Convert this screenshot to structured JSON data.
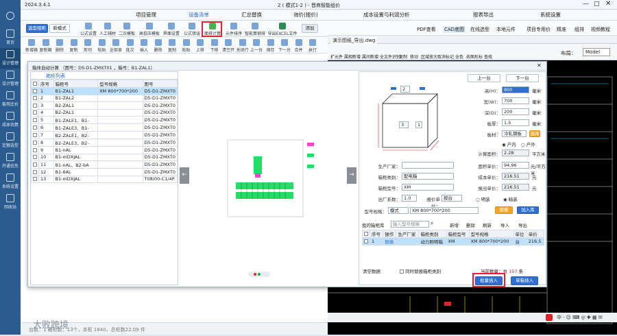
{
  "app": {
    "version": "2024.3.4.1",
    "window_title": "2 ( 模式1-2 ) - 晋商智能组价"
  },
  "sidebar": {
    "items": [
      {
        "label": "首页"
      },
      {
        "label": "设计管理"
      },
      {
        "label": "设计管理"
      },
      {
        "label": "套用比价"
      },
      {
        "label": "成本估算"
      },
      {
        "label": "定额选型"
      },
      {
        "label": "开通优先"
      },
      {
        "label": "系统设置"
      },
      {
        "label": "回收站"
      }
    ]
  },
  "menu": [
    "项目管理",
    "设备清单",
    "汇总替换",
    "询价(报价)",
    "成本设置与利润分析",
    "报表导出",
    "系统设置"
  ],
  "toolbar1": {
    "mode_btn": "选型组柜",
    "std_mode": "新模式",
    "items": [
      "公式设置",
      "人工辅材",
      "二次模板",
      "高低压模板",
      "界面设置",
      "公式错误",
      "面排计算",
      "元件排序",
      "智能算钢排",
      "导出EXCEL文件"
    ],
    "add": "添加",
    "right": [
      "PDF查看",
      "CAD底图",
      "在线选型",
      "本地元件",
      "项目专用价",
      "精准",
      "组排",
      "视频教程"
    ]
  },
  "toolbar2": [
    "新增箱号",
    "复制箱号",
    "删除",
    "复制",
    "剪切",
    "粘贴",
    "全部显示",
    "批次",
    "插入",
    "删除",
    "复制",
    "粘贴",
    "上移",
    "下移",
    "清空开票行",
    "关闭行",
    "上一台",
    "保存",
    "下一台",
    "合并",
    "执行"
  ],
  "cad": {
    "tab": "演示图纸_导出.dwg",
    "layout_label": "布局：",
    "layout_value": "Model",
    "tools": [
      "扩元件",
      "属相新增",
      "属间新增",
      "全文件识别",
      "复制",
      "移动",
      "区域放大",
      "取消标记",
      "全色",
      "去图形标",
      "查找"
    ]
  },
  "dialog": {
    "title": "箱体自动计算  （图号：D5-D1-ZMXT01 ，箱号：B1-ZAL1）",
    "tab": "箱柜列表",
    "columns": [
      "序号",
      "箱柜号",
      "型号规格",
      "图号"
    ],
    "rows": [
      [
        "1",
        "B1-ZAL1",
        "XM 800*700*200",
        "D5-D1-ZMXT0"
      ],
      [
        "2",
        "B1-ZAL2",
        "",
        "D5-D1-ZMXT0"
      ],
      [
        "3",
        "B2-ZAL1",
        "",
        "D5-D1-ZMXT0"
      ],
      [
        "4",
        "B2-ZAL1",
        "",
        "D5-D1-ZMXT0"
      ],
      [
        "5",
        "B1-ZALE1、B1-",
        "",
        "D5-D1-ZMXT0"
      ],
      [
        "6",
        "B1-ZALE3、B1-",
        "",
        "D5-D1-ZMXT0"
      ],
      [
        "7",
        "B2-ZALE1、B2-",
        "",
        "D5-D1-ZMXT0"
      ],
      [
        "8",
        "B2-ZALE3、B2-",
        "",
        "D5-D1-ZMXT0"
      ],
      [
        "9",
        "B1-nAL",
        "",
        "D5-D1-ZMXT0"
      ],
      [
        "10",
        "B1-mDXJAL",
        "",
        "D5-D1-ZMXT0"
      ],
      [
        "11",
        "B1-nAL、B2-bA",
        "",
        "D5-D1-ZMXT0"
      ],
      [
        "12",
        "B1-6AL",
        "",
        "D5-D1-ZMXT0"
      ],
      [
        "13",
        "B1-mDXJAL",
        "",
        "T08/00-C1/4P"
      ]
    ],
    "prev": "上一台",
    "next": "下一台",
    "dims": {
      "width_box": "2",
      "height_box": "3",
      "depth_box": "1"
    },
    "form": {
      "height_label": "高(H)：",
      "height": "800",
      "width_label": "宽(W)：",
      "width": "700",
      "depth_label": "深(D)：",
      "depth": "200",
      "thick_label": "板厚：",
      "thick": "1.5",
      "mat_label": "板材：",
      "mat": "冷轧钢板",
      "mat_btn": "选择",
      "radio1": "户内",
      "radio2": "户外",
      "area_label": "计算面积：",
      "area": "2.28",
      "area_unit": "平方米",
      "unit": "毫米",
      "mfr_label": "生产厂家：",
      "price_label": "面积单价：",
      "price": "94.96",
      "price_unit": "元/平方米",
      "cab_type_label": "箱柜类别：",
      "cab_type": "配电箱",
      "cost_label": "成本单价：",
      "cost": "216.51",
      "yuan": "元",
      "model_label": "箱柜型号：",
      "model": "XM",
      "quote_label": "报出单价：",
      "quote": "216.51",
      "factory_label": "出厂系数：",
      "factory": "1.0",
      "quote_unit_label": "报价单位：",
      "quote_unit": "按台",
      "r_open": "明装",
      "r_hide": "暗装",
      "spec_label": "型号规格：",
      "spec_mode": "模式",
      "spec": "XM 800*700*200",
      "replace_btn": "替换",
      "add_lib_btn": "加入库",
      "lib_label": "我的箱柜库",
      "lib_placeholder": "输入型号规格",
      "lib_actions": [
        "新增",
        "删除",
        "刷新",
        "导入",
        "导出"
      ]
    },
    "lib_columns": [
      "序号",
      "操作",
      "生产厂家",
      "箱柜类别",
      "箱柜型号",
      "型号规格",
      "单位",
      "单价"
    ],
    "lib_row": [
      "1",
      "替换",
      "",
      "动力照明箱",
      "XM",
      "XM 800*700*200",
      "台",
      "216.5"
    ],
    "clear": "清空数据",
    "same_replace": "同时替换箱柜类别",
    "count_label": "当前数量：共",
    "count": "157",
    "count_unit": "条",
    "batch_insert": "批量插入",
    "single_insert": "单箱插入"
  },
  "status": {
    "left": "台数：1 箱柜数：13个，本柜 1840，总柜数22.09 件",
    "watermark": "大败跨境"
  }
}
